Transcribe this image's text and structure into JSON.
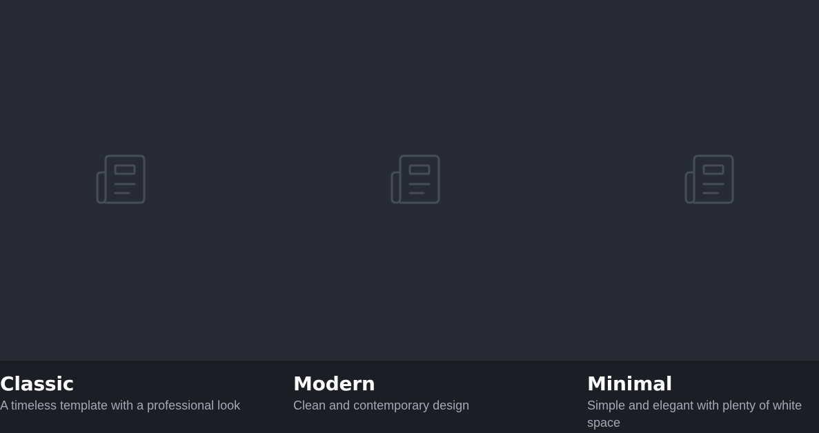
{
  "templates": [
    {
      "title": "Classic",
      "description": "A timeless template with a professional look",
      "icon": "newspaper-icon"
    },
    {
      "title": "Modern",
      "description": "Clean and contemporary design",
      "icon": "newspaper-icon"
    },
    {
      "title": "Minimal",
      "description": "Simple and elegant with plenty of white space",
      "icon": "newspaper-icon"
    }
  ],
  "colors": {
    "page_background": "#1b1e25",
    "preview_background": "#262b36",
    "icon_stroke": "#464c59",
    "title_text": "#ffffff",
    "description_text": "#a2a8b5"
  }
}
